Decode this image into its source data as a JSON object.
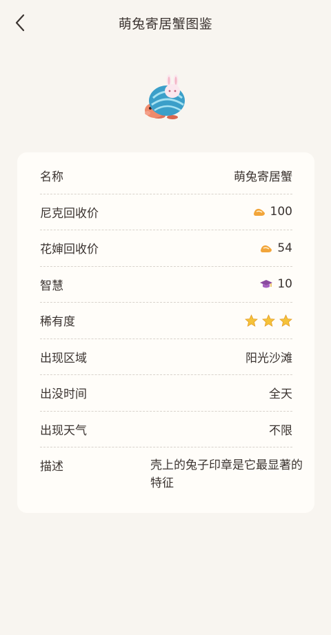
{
  "header": {
    "title": "萌兔寄居蟹图鉴"
  },
  "icons": {
    "back": "chevron-left-icon",
    "shoe": "shoe-coin-icon",
    "wisdom": "graduation-cap-icon",
    "star": "star-icon"
  },
  "colors": {
    "background": "#f8f5f0",
    "card": "#fffdf9",
    "coin": "#f2a53a",
    "cap": "#8a4aa0",
    "star": "#f5c23a"
  },
  "details": {
    "name": {
      "label": "名称",
      "value": "萌兔寄居蟹"
    },
    "nick_price": {
      "label": "尼克回收价",
      "value": "100"
    },
    "huaxi_price": {
      "label": "花婶回收价",
      "value": "54"
    },
    "wisdom": {
      "label": "智慧",
      "value": "10"
    },
    "rarity": {
      "label": "稀有度",
      "stars": 3
    },
    "area": {
      "label": "出现区域",
      "value": "阳光沙滩"
    },
    "time": {
      "label": "出没时间",
      "value": "全天"
    },
    "weather": {
      "label": "出现天气",
      "value": "不限"
    },
    "description": {
      "label": "描述",
      "value": "壳上的兔子印章是它最显著的特征"
    }
  }
}
